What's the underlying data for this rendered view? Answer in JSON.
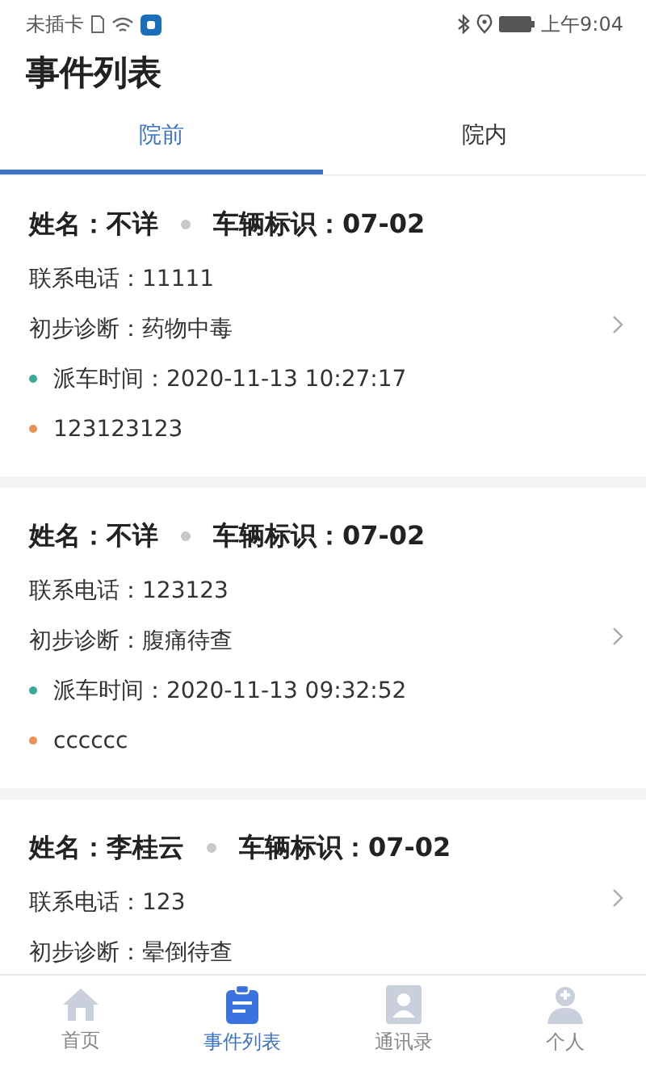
{
  "status_bar": {
    "carrier": "未插卡",
    "time": "上午9:04"
  },
  "title": "事件列表",
  "tabs": [
    {
      "label": "院前",
      "selected": true
    },
    {
      "label": "院内",
      "selected": false
    }
  ],
  "events": [
    {
      "name": "姓名：不详",
      "vehicle": "车辆标识：07-02",
      "phone": "联系电话：11111",
      "diagnosis": "初步诊断：药物中毒",
      "dispatch_time": "派车时间：2020-11-13 10:27:17",
      "note": "123123123"
    },
    {
      "name": "姓名：不详",
      "vehicle": "车辆标识：07-02",
      "phone": "联系电话：123123",
      "diagnosis": "初步诊断：腹痛待查",
      "dispatch_time": "派车时间：2020-11-13 09:32:52",
      "note": "cccccc"
    },
    {
      "name": "姓名：李桂云",
      "vehicle": "车辆标识：07-02",
      "phone": "联系电话：123",
      "diagnosis": "初步诊断：晕倒待查"
    }
  ],
  "bottom_nav": [
    {
      "label": "首页",
      "kind": "home",
      "selected": false
    },
    {
      "label": "事件列表",
      "kind": "list",
      "selected": true
    },
    {
      "label": "通讯录",
      "kind": "contacts",
      "selected": false
    },
    {
      "label": "个人",
      "kind": "person",
      "selected": false
    }
  ]
}
